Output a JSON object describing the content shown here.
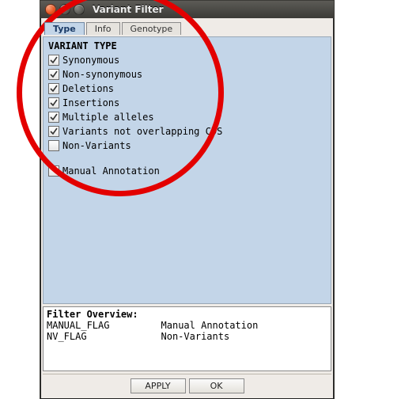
{
  "window": {
    "title": "Variant Filter"
  },
  "tabs": [
    {
      "label": "Type",
      "active": true
    },
    {
      "label": "Info",
      "active": false
    },
    {
      "label": "Genotype",
      "active": false
    }
  ],
  "section": {
    "title": "VARIANT TYPE"
  },
  "filters": [
    {
      "label": "Synonymous",
      "checked": true
    },
    {
      "label": "Non-synonymous",
      "checked": true
    },
    {
      "label": "Deletions",
      "checked": true
    },
    {
      "label": "Insertions",
      "checked": true
    },
    {
      "label": "Multiple alleles",
      "checked": true
    },
    {
      "label": "Variants not overlapping CDS",
      "checked": true
    },
    {
      "label": "Non-Variants",
      "checked": false
    }
  ],
  "extra_filters": [
    {
      "label": "Manual Annotation",
      "checked": false
    }
  ],
  "overview": {
    "title": "Filter Overview:",
    "rows": [
      {
        "flag": "MANUAL_FLAG",
        "desc": "Manual Annotation"
      },
      {
        "flag": "NV_FLAG",
        "desc": "Non-Variants"
      }
    ]
  },
  "buttons": {
    "apply": "APPLY",
    "ok": "OK"
  }
}
